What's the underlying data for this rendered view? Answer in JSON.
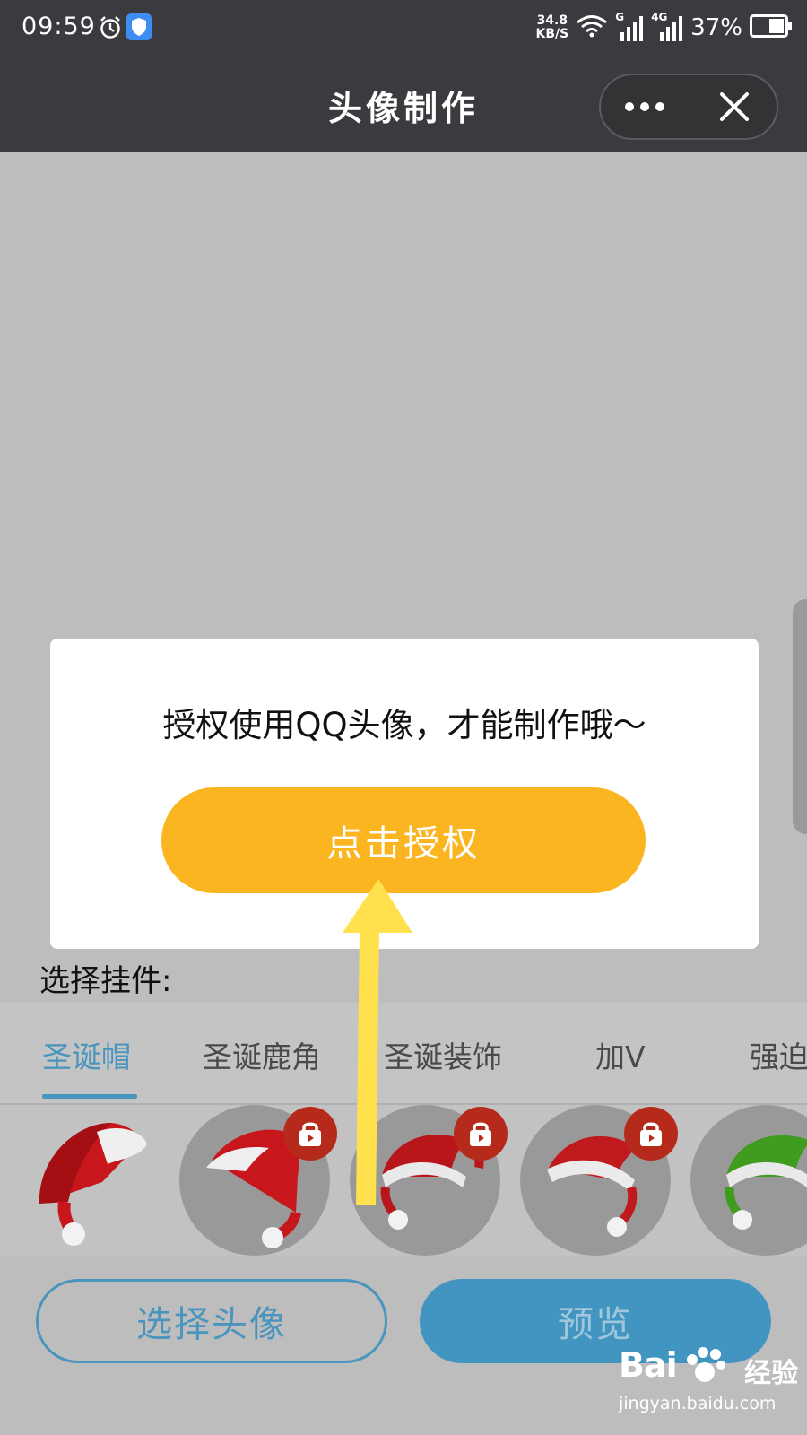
{
  "status_bar": {
    "time": "09:59",
    "net_speed_value": "34.8",
    "net_speed_unit": "KB/S",
    "signal_1_label": "G",
    "signal_2_label": "4G",
    "battery_percent": "37%"
  },
  "nav": {
    "title": "头像制作"
  },
  "modal": {
    "message": "授权使用QQ头像，才能制作哦～",
    "authorize_button": "点击授权"
  },
  "section_label": "选择挂件:",
  "tabs": [
    {
      "label": "圣诞帽",
      "active": true
    },
    {
      "label": "圣诞鹿角",
      "active": false
    },
    {
      "label": "圣诞装饰",
      "active": false
    },
    {
      "label": "加V",
      "active": false
    },
    {
      "label": "强迫",
      "active": false
    }
  ],
  "pendants": [
    {
      "icon": "red-santa-hat-icon",
      "locked": false
    },
    {
      "icon": "red-santa-hat-icon",
      "locked": true
    },
    {
      "icon": "red-christmas-hat-icon",
      "locked": true
    },
    {
      "icon": "red-christmas-hat-icon",
      "locked": true
    },
    {
      "icon": "green-christmas-hat-icon",
      "locked": false
    }
  ],
  "buttons": {
    "choose_avatar": "选择头像",
    "preview": "预览"
  },
  "watermark": {
    "logo": "Bai",
    "logo_cn": "经验",
    "url": "jingyan.baidu.com"
  },
  "colors": {
    "accent_blue": "#4a95bd",
    "auth_orange": "#fbb521",
    "annotation_yellow": "#ffe14d"
  }
}
